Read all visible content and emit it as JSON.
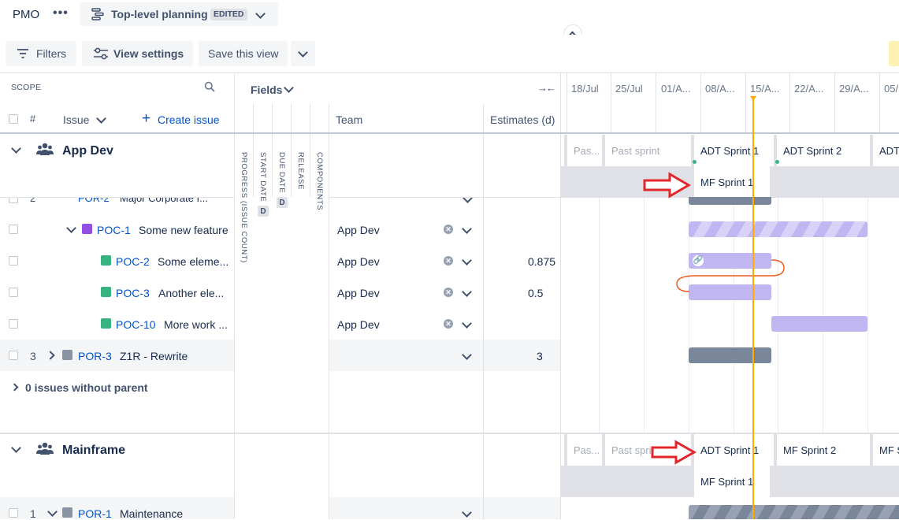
{
  "topbar": {
    "project": "PMO",
    "plan_title": "Top-level planning",
    "edited_badge": "EDITED"
  },
  "toolbar": {
    "filters": "Filters",
    "view_settings": "View settings",
    "save_view": "Save this view"
  },
  "scope_header": {
    "scope": "SCOPE",
    "hash": "#",
    "issue": "Issue",
    "create_issue": "Create issue",
    "fields": "Fields",
    "team": "Team",
    "estimates": "Estimates (d)"
  },
  "vertical_fields": [
    "PROGRESS (ISSUE COUNT)",
    "START DATE",
    "DUE DATE",
    "RELEASE",
    "COMPONENTS"
  ],
  "date_badge": "D",
  "timeline_dates": [
    "18/Jul",
    "25/Jul",
    "01/A...",
    "08/A...",
    "15/A...",
    "22/A...",
    "29/A...",
    "05/"
  ],
  "groups": [
    {
      "name": "App Dev",
      "sprints_row1": [
        "Pas...",
        "Past sprint",
        "ADT Sprint 1",
        "ADT Sprint 2",
        "ADT"
      ],
      "sprints_row2": [
        "MF Sprint 1"
      ]
    },
    {
      "name": "Mainframe",
      "sprints_row1": [
        "Pas...",
        "Past spri",
        "ADT Sprint 1",
        "MF Sprint 2",
        "MF S"
      ],
      "sprints_row2": [
        "MF Sprint 1"
      ]
    }
  ],
  "rows": [
    {
      "num": "2",
      "key": "POR-2",
      "summary": "Major Corporate I...",
      "team": "",
      "estimate": ""
    },
    {
      "num": "",
      "key": "POC-1",
      "summary": "Some new feature",
      "team": "App Dev",
      "estimate": ""
    },
    {
      "num": "",
      "key": "POC-2",
      "summary": "Some eleme...",
      "team": "App Dev",
      "estimate": "0.875"
    },
    {
      "num": "",
      "key": "POC-3",
      "summary": "Another ele...",
      "team": "App Dev",
      "estimate": "0.5"
    },
    {
      "num": "",
      "key": "POC-10",
      "summary": "More work ...",
      "team": "App Dev",
      "estimate": ""
    },
    {
      "num": "3",
      "key": "POR-3",
      "summary": "Z1R - Rewrite",
      "team": "",
      "estimate": "3"
    }
  ],
  "issues_without_parent": "0 issues without parent",
  "mainframe_row": {
    "num": "1",
    "key": "POR-1",
    "summary": "Maintenance"
  },
  "colors": {
    "accent_link": "#0052cc",
    "today_line": "#ffab00",
    "annotation_arrow": "#e3262b",
    "epic_bar": "#c0b6f2",
    "initiative_bar": "#7a869a"
  }
}
